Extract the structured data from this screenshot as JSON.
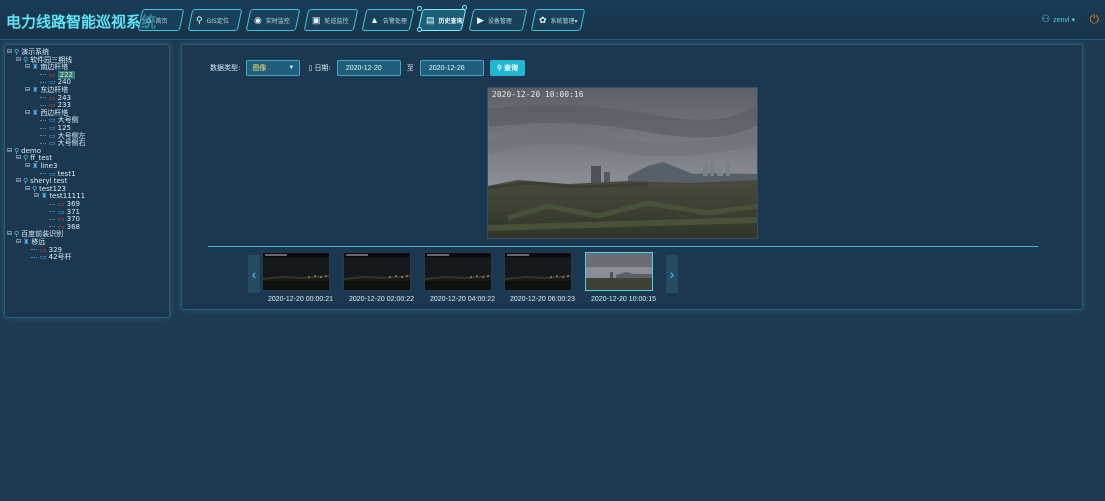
{
  "header": {
    "title": "电力线路智能巡视系统",
    "nav": [
      {
        "icon": "home-icon",
        "glyph": "⌂",
        "label": "首页"
      },
      {
        "icon": "map-pin-icon",
        "glyph": "⚲",
        "label": "GIS定位"
      },
      {
        "icon": "camera-icon",
        "glyph": "◉",
        "label": "实时监控"
      },
      {
        "icon": "patrol-icon",
        "glyph": "▣",
        "label": "轮巡监控"
      },
      {
        "icon": "warning-icon",
        "glyph": "▲",
        "label": "告警处理"
      },
      {
        "icon": "image-icon",
        "glyph": "▤",
        "label": "历史查询"
      },
      {
        "icon": "device-icon",
        "glyph": "▶",
        "label": "设备管理"
      },
      {
        "icon": "gear-icon",
        "glyph": "✿",
        "label": "系统管理▾"
      }
    ],
    "active_nav": 5,
    "user": "zenvl ▾",
    "user_icon": "user-icon",
    "power_icon": "power-icon"
  },
  "tree": [
    {
      "label": "演示系统",
      "icon": "⚲",
      "cls": "",
      "toggle": "⊟"
    },
    {
      "label": "软件园三期线",
      "icon": "⚲",
      "cls": "",
      "toggle": "⊟"
    },
    {
      "label": "南边杆塔",
      "icon": "♜",
      "cls": "blue",
      "toggle": "⊟"
    },
    {
      "label": "222",
      "icon": "▭",
      "cls": "red",
      "toggle": ""
    },
    {
      "label": "240",
      "icon": "▭",
      "cls": "blue",
      "toggle": ""
    },
    {
      "label": "东边杆塔",
      "icon": "♜",
      "cls": "blue",
      "toggle": "⊟"
    },
    {
      "label": "243",
      "icon": "▭",
      "cls": "red",
      "toggle": ""
    },
    {
      "label": "233",
      "icon": "▭",
      "cls": "red",
      "toggle": ""
    },
    {
      "label": "西边杆塔",
      "icon": "♜",
      "cls": "blue",
      "toggle": "⊟"
    },
    {
      "label": "大号侧",
      "icon": "▭",
      "cls": "blue",
      "toggle": ""
    },
    {
      "label": "125",
      "icon": "▭",
      "cls": "blue",
      "toggle": ""
    },
    {
      "label": "大号侧左",
      "icon": "▭",
      "cls": "blue",
      "toggle": ""
    },
    {
      "label": "大号侧右",
      "icon": "▭",
      "cls": "blue",
      "toggle": ""
    },
    {
      "label": "demo",
      "icon": "⚲",
      "cls": "",
      "toggle": "⊟"
    },
    {
      "label": "ff_test",
      "icon": "⚲",
      "cls": "",
      "toggle": "⊟"
    },
    {
      "label": "line3",
      "icon": "♜",
      "cls": "blue",
      "toggle": "⊟"
    },
    {
      "label": "test1",
      "icon": "▭",
      "cls": "blue",
      "toggle": ""
    },
    {
      "label": "sheryl test",
      "icon": "⚲",
      "cls": "",
      "toggle": "⊟"
    },
    {
      "label": "test123",
      "icon": "⚲",
      "cls": "",
      "toggle": "⊟"
    },
    {
      "label": "test11111",
      "icon": "♜",
      "cls": "blue",
      "toggle": "⊟"
    },
    {
      "label": "369",
      "icon": "▭",
      "cls": "red",
      "toggle": ""
    },
    {
      "label": "371",
      "icon": "▭",
      "cls": "blue",
      "toggle": ""
    },
    {
      "label": "370",
      "icon": "▭",
      "cls": "red",
      "toggle": ""
    },
    {
      "label": "368",
      "icon": "▭",
      "cls": "red",
      "toggle": ""
    },
    {
      "label": "百度前装识别",
      "icon": "⚲",
      "cls": "",
      "toggle": "⊟"
    },
    {
      "label": "移远",
      "icon": "♜",
      "cls": "blue",
      "toggle": "⊟"
    },
    {
      "label": "329",
      "icon": "▭",
      "cls": "red",
      "toggle": ""
    },
    {
      "label": "42号杆",
      "icon": "▭",
      "cls": "blue",
      "toggle": ""
    }
  ],
  "selected_tree_index": 3,
  "filter": {
    "type_label": "数据类型:",
    "type_value": "图像",
    "date_label": "日期:",
    "start_date": "2020-12-20",
    "sep": "至",
    "end_date": "2020-12-26",
    "query_label": "查询",
    "query_icon": "search-icon"
  },
  "photo": {
    "timestamp": "2020-12-20 10:00:16"
  },
  "thumbnails": [
    {
      "label": "2020-12-20 00:00:21",
      "night": true
    },
    {
      "label": "2020-12-20 02:00:22",
      "night": true
    },
    {
      "label": "2020-12-20 04:00:22",
      "night": true
    },
    {
      "label": "2020-12-20 06:00:23",
      "night": true
    },
    {
      "label": "2020-12-20 10:00:15",
      "night": false
    }
  ],
  "selected_thumb": 4,
  "carousel": {
    "prev": "‹",
    "next": "›"
  },
  "colors": {
    "accent": "#4fd0e8",
    "brand": "#5fe3f5",
    "bg": "#1e3a52",
    "alarm": "#e03a3a"
  }
}
